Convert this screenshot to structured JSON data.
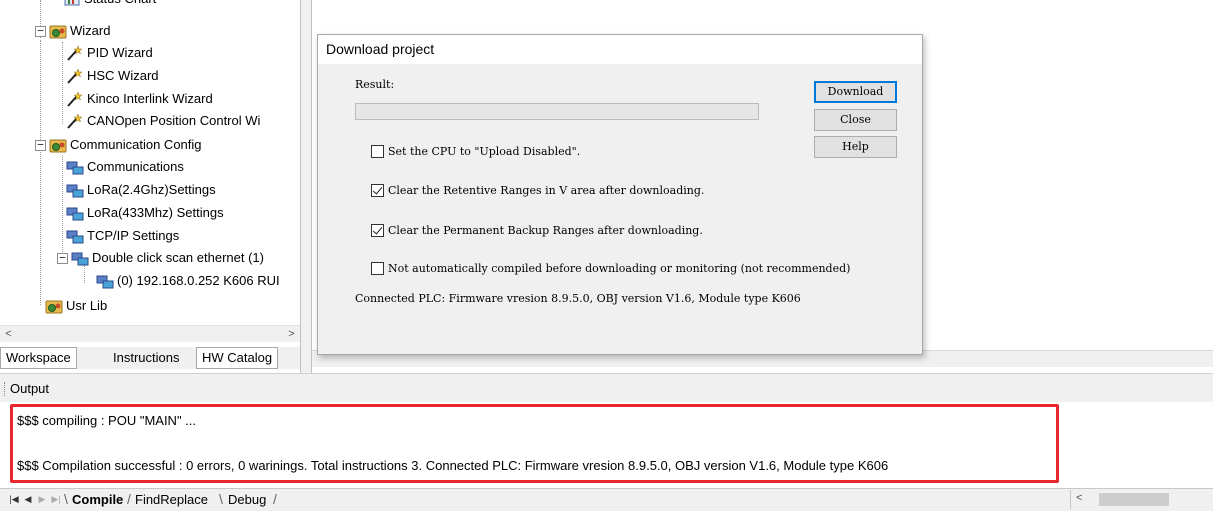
{
  "workspace": {
    "tree": [
      {
        "label": "Status Chart",
        "level": 2
      },
      {
        "label": "Wizard",
        "level": 1
      },
      {
        "label": "PID Wizard",
        "level": 2
      },
      {
        "label": "HSC Wizard",
        "level": 2
      },
      {
        "label": "Kinco Interlink Wizard",
        "level": 2
      },
      {
        "label": "CANOpen Position Control Wi",
        "level": 2
      },
      {
        "label": "Communication Config",
        "level": 1
      },
      {
        "label": "Communications",
        "level": 2
      },
      {
        "label": "LoRa(2.4Ghz)Settings",
        "level": 2
      },
      {
        "label": "LoRa(433Mhz) Settings",
        "level": 2
      },
      {
        "label": "TCP/IP Settings",
        "level": 2
      },
      {
        "label": "Double click scan ethernet (1)",
        "level": 2
      },
      {
        "label": "(0) 192.168.0.252 K606 RUI",
        "level": 3
      },
      {
        "label": "Usr Lib",
        "level": 1
      }
    ],
    "tabs": [
      "Workspace",
      "Instructions",
      "HW Catalog"
    ]
  },
  "dialog": {
    "title": "Download project",
    "result_label": "Result:",
    "progress": 0,
    "buttons": {
      "download": "Download",
      "close": "Close",
      "help": "Help"
    },
    "checkboxes": [
      {
        "label": "Set the CPU to \"Upload Disabled\".",
        "checked": false
      },
      {
        "label": "Clear the Retentive Ranges in V area after downloading.",
        "checked": true
      },
      {
        "label": "Clear the Permanent Backup Ranges after downloading.",
        "checked": true
      },
      {
        "label": "Not automatically compiled before downloading or monitoring (not recommended)",
        "checked": false
      }
    ],
    "status": "Connected PLC: Firmware vresion 8.9.5.0, OBJ version V1.6, Module type K606"
  },
  "output": {
    "title": "Output",
    "lines": [
      "$$$ compiling   : POU \"MAIN\" ...",
      "$$$ Compilation successful   : 0 errors, 0 warinings.  Total instructions 3. Connected PLC: Firmware vresion 8.9.5.0, OBJ version V1.6, Module type K606"
    ],
    "highlight_color": "#e8262b"
  },
  "bottom_tabs": [
    "Compile",
    "FindReplace",
    "Debug"
  ],
  "icons": {
    "folder": "folder-gear-icon",
    "wizard": "magic-wand-icon",
    "network": "network-icon"
  }
}
